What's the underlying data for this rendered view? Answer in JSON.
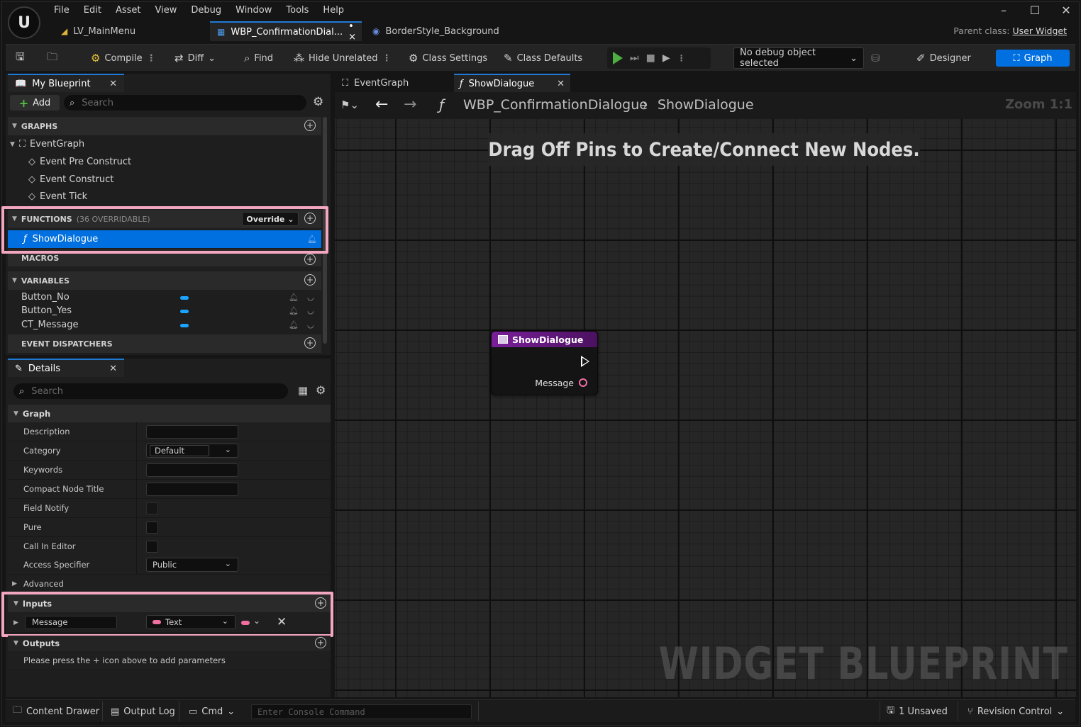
{
  "menu": [
    "File",
    "Edit",
    "Asset",
    "View",
    "Debug",
    "Window",
    "Tools",
    "Help"
  ],
  "doc_tabs": [
    {
      "label": "LV_MainMenu"
    },
    {
      "label": "WBP_ConfirmationDial...",
      "suffix": "• ×"
    },
    {
      "label": "BorderStyle_Background"
    }
  ],
  "parent_class": {
    "label": "Parent class:",
    "value": "User Widget"
  },
  "toolbar": {
    "compile": "Compile",
    "diff": "Diff",
    "find": "Find",
    "hide_unrelated": "Hide Unrelated",
    "class_settings": "Class Settings",
    "class_defaults": "Class Defaults",
    "debug_object": "No debug object selected",
    "designer": "Designer",
    "graph": "Graph"
  },
  "my_blueprint": {
    "tab": "My Blueprint",
    "add": "Add",
    "search_placeholder": "Search",
    "graphs_header": "GRAPHS",
    "event_graph": "EventGraph",
    "events": [
      "Event Pre Construct",
      "Event Construct",
      "Event Tick"
    ],
    "functions_header": "FUNCTIONS",
    "functions_sub": "(36 OVERRIDABLE)",
    "override": "Override",
    "selected_function": "ShowDialogue",
    "macros_header": "MACROS",
    "variables_header": "VARIABLES",
    "variables": [
      "Button_No",
      "Button_Yes",
      "CT_Message"
    ],
    "dispatchers_header": "EVENT DISPATCHERS"
  },
  "details": {
    "tab": "Details",
    "search_placeholder": "Search",
    "graph_section": "Graph",
    "rows": {
      "description": "Description",
      "category": "Category",
      "category_value": "Default",
      "keywords": "Keywords",
      "compact_title": "Compact Node Title",
      "field_notify": "Field Notify",
      "pure": "Pure",
      "call_in_editor": "Call In Editor",
      "access_specifier": "Access Specifier",
      "access_value": "Public"
    },
    "advanced": "Advanced",
    "inputs": "Inputs",
    "input_name": "Message",
    "input_type": "Text",
    "outputs": "Outputs",
    "outputs_hint": "Please press the + icon above to add parameters"
  },
  "graph": {
    "tabs": [
      "EventGraph",
      "ShowDialogue"
    ],
    "breadcrumb_root": "WBP_ConfirmationDialogue",
    "breadcrumb_leaf": "ShowDialogue",
    "zoom": "Zoom 1:1",
    "hint": "Drag Off Pins to Create/Connect New Nodes.",
    "watermark": "WIDGET BLUEPRINT",
    "node_title": "ShowDialogue",
    "node_pin": "Message"
  },
  "status": {
    "content_drawer": "Content Drawer",
    "output_log": "Output Log",
    "cmd": "Cmd",
    "console_placeholder": "Enter Console Command",
    "unsaved": "1 Unsaved",
    "revision": "Revision Control"
  },
  "colors": {
    "accent": "#0070e0",
    "highlight": "#f3a6c0",
    "node_header": "#7a1f9a",
    "text_pin": "#f06fa2",
    "var_pin": "#1aa4ff"
  }
}
